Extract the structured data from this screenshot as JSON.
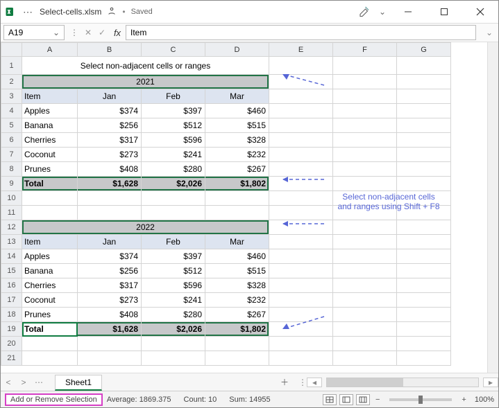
{
  "title": {
    "filename": "Select-cells.xlsm",
    "saved": "Saved"
  },
  "formula_bar": {
    "cell_ref": "A19",
    "formula": "Item"
  },
  "columns": [
    "A",
    "B",
    "C",
    "D",
    "E",
    "F",
    "G"
  ],
  "row_numbers": [
    1,
    2,
    3,
    4,
    5,
    6,
    7,
    8,
    9,
    10,
    11,
    12,
    13,
    14,
    15,
    16,
    17,
    18,
    19,
    20,
    21
  ],
  "sheet": {
    "title": "Select non-adjacent cells or ranges",
    "year1": "2021",
    "year2": "2022",
    "hdr_item": "Item",
    "months": [
      "Jan",
      "Feb",
      "Mar"
    ],
    "rows1": [
      {
        "item": "Apples",
        "b": "$374",
        "c": "$397",
        "d": "$460"
      },
      {
        "item": "Banana",
        "b": "$256",
        "c": "$512",
        "d": "$515"
      },
      {
        "item": "Cherries",
        "b": "$317",
        "c": "$596",
        "d": "$328"
      },
      {
        "item": "Coconut",
        "b": "$273",
        "c": "$241",
        "d": "$232"
      },
      {
        "item": "Prunes",
        "b": "$408",
        "c": "$280",
        "d": "$267"
      }
    ],
    "total_label": "Total",
    "totals1": {
      "b": "$1,628",
      "c": "$2,026",
      "d": "$1,802"
    },
    "rows2": [
      {
        "item": "Apples",
        "b": "$374",
        "c": "$397",
        "d": "$460"
      },
      {
        "item": "Banana",
        "b": "$256",
        "c": "$512",
        "d": "$515"
      },
      {
        "item": "Cherries",
        "b": "$317",
        "c": "$596",
        "d": "$328"
      },
      {
        "item": "Coconut",
        "b": "$273",
        "c": "$241",
        "d": "$232"
      },
      {
        "item": "Prunes",
        "b": "$408",
        "c": "$280",
        "d": "$267"
      }
    ],
    "totals2": {
      "b": "$1,628",
      "c": "$2,026",
      "d": "$1,802"
    }
  },
  "annotation": {
    "line1": "Select non-adjacent cells",
    "line2": "and ranges using Shift + F8"
  },
  "tabs": {
    "sheet1": "Sheet1"
  },
  "statusbar": {
    "mode": "Add or Remove Selection",
    "avg_label": "Average:",
    "avg": "1869.375",
    "count_label": "Count:",
    "count": "10",
    "sum_label": "Sum:",
    "sum": "14955",
    "zoom": "100%"
  }
}
